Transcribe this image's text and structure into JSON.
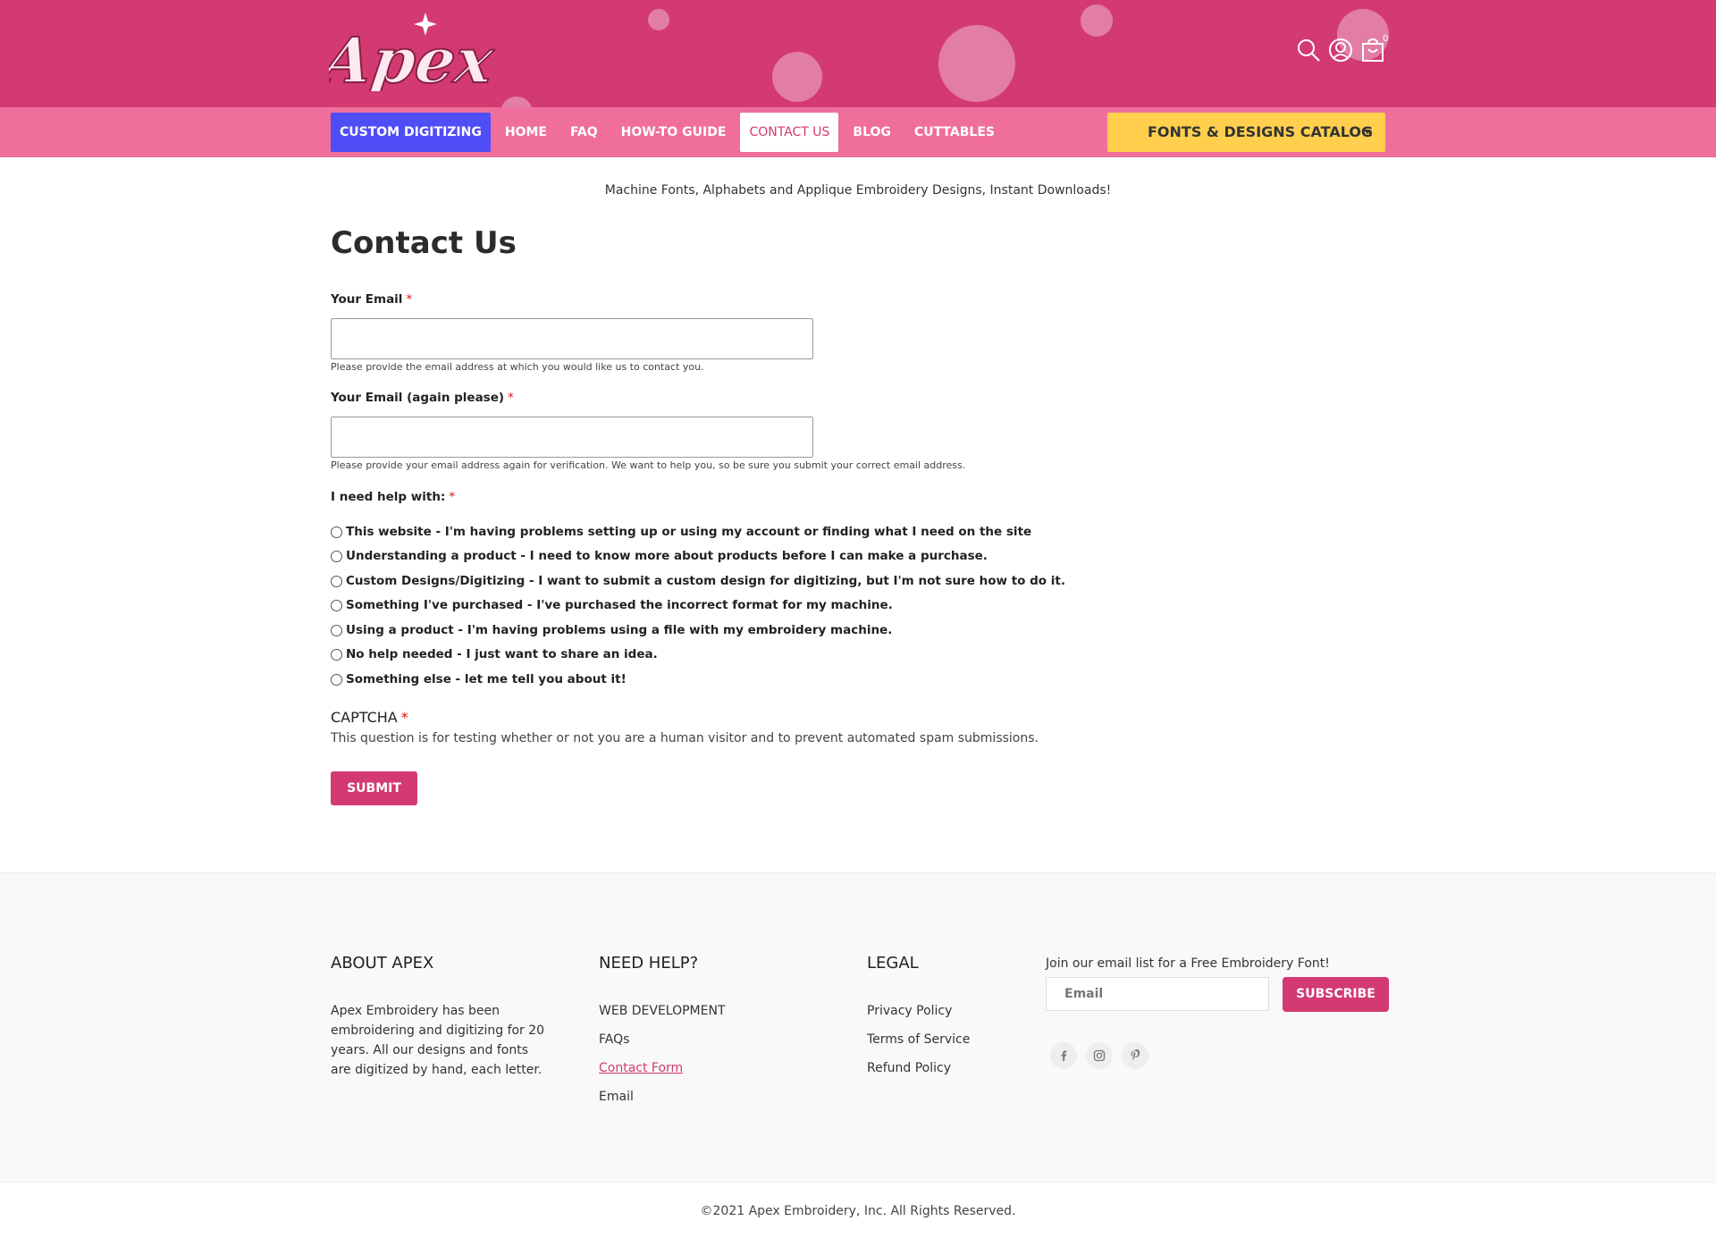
{
  "header": {
    "logo_text": "Apex",
    "cart_count": "0",
    "icons": [
      "search-icon",
      "account-icon",
      "cart-icon"
    ]
  },
  "nav": {
    "items": [
      {
        "label": "CUSTOM DIGITIZING"
      },
      {
        "label": "HOME"
      },
      {
        "label": "FAQ"
      },
      {
        "label": "HOW-TO GUIDE"
      },
      {
        "label": "CONTACT US"
      },
      {
        "label": "BLOG"
      },
      {
        "label": "CUTTABLES"
      }
    ],
    "active": "CONTACT US",
    "catalog_label": "FONTS & DESIGNS CATALOG"
  },
  "tagline": "Machine Fonts, Alphabets and Applique Embroidery Designs, Instant Downloads!",
  "page_title": "Contact Us",
  "form": {
    "email_label": "Your Email",
    "email_value": "",
    "email_help": "Please provide the email address at which you would like us to contact you.",
    "email2_label": "Your Email (again please)",
    "email2_value": "",
    "email2_help": "Please provide your email address again for verification. We want to help you, so be sure you submit your correct email address.",
    "help_label": "I need help with:",
    "required_mark": "*",
    "options": [
      "This website - I'm having problems setting up or using my account or finding what I need on the site",
      "Understanding a product - I need to know more about products before I can make a purchase.",
      "Custom Designs/Digitizing - I want to submit a custom design for digitizing, but I'm not sure how to do it.",
      "Something I've purchased - I've purchased the incorrect format for my machine.",
      "Using a product - I'm having problems using a file with my embroidery machine.",
      "No help needed - I just want to share an idea.",
      "Something else - let me tell you about it!"
    ],
    "captcha_title": "CAPTCHA",
    "captcha_desc": "This question is for testing whether or not you are a human visitor and to prevent automated spam submissions.",
    "submit_label": "SUBMIT"
  },
  "footer": {
    "about_title": "ABOUT APEX",
    "about_text": "Apex Embroidery has been embroidering and digitizing for 20 years. All our designs and fonts are digitized by hand, each letter.",
    "help_title": "NEED HELP?",
    "help_links": [
      "WEB DEVELOPMENT",
      "FAQs",
      "Contact Form",
      "Email"
    ],
    "legal_title": "LEGAL",
    "legal_links": [
      "Privacy Policy",
      "Terms of Service",
      "Refund Policy"
    ],
    "newsletter_text": "Join our email list for a Free Embroidery Font!",
    "email_placeholder": "Email",
    "subscribe_label": "SUBSCRIBE",
    "social": [
      "facebook-icon",
      "instagram-icon",
      "pinterest-icon"
    ]
  },
  "copyright": "©2021 Apex Embroidery, Inc. All Rights Reserved.",
  "colors": {
    "brand_pink": "#d33a72",
    "nav_pink": "#ef6e9b",
    "digitizing_blue": "#4f4df5",
    "catalog_yellow": "#ffcf4d"
  }
}
